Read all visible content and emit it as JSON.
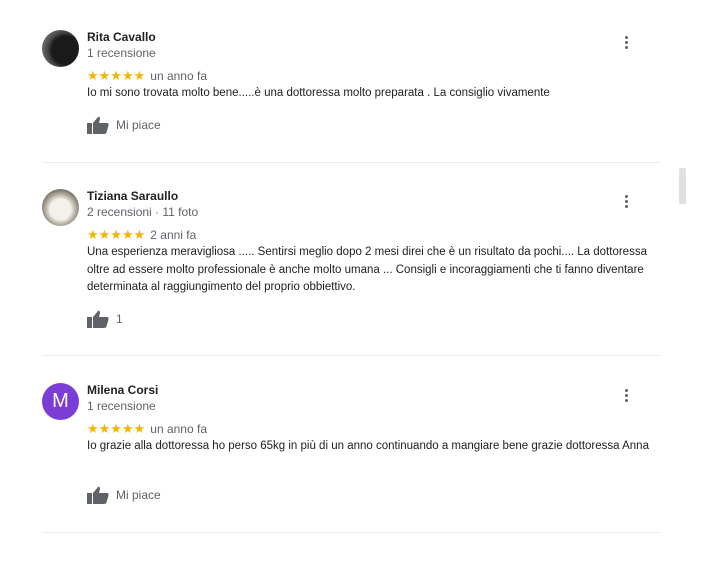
{
  "reviews": [
    {
      "name": "Rita Cavallo",
      "sub": "1 recensione",
      "stars": "★★★★★",
      "time": "un anno fa",
      "text": "Io mi sono trovata molto bene.....è una dottoressa molto preparata . La consiglio vivamente",
      "like": "Mi piace",
      "avatar_letter": ""
    },
    {
      "name": "Tiziana Saraullo",
      "sub": "2 recensioni · 11 foto",
      "stars": "★★★★★",
      "time": "2 anni fa",
      "text": "Una esperienza meravigliosa ..... Sentirsi meglio dopo 2 mesi direi che è un risultato da pochi.... La dottoressa oltre ad essere molto professionale è anche molto umana ... Consigli e incoraggiamenti che ti fanno diventare determinata al raggiungimento del proprio obbiettivo.",
      "like": "1",
      "avatar_letter": ""
    },
    {
      "name": "Milena Corsi",
      "sub": "1 recensione",
      "stars": "★★★★★",
      "time": "un anno fa",
      "text": "Io grazie alla dottoressa ho perso 65kg in più di un anno continuando a mangiare bene grazie dottoressa Anna",
      "like": "Mi piace",
      "avatar_letter": "M"
    }
  ],
  "colors": {
    "star": "#f4b400",
    "avatar_m": "#7c3dd6",
    "muted": "#5f6368"
  },
  "icons": {
    "like": "thumbs-up-icon",
    "more": "more-vert-icon"
  }
}
